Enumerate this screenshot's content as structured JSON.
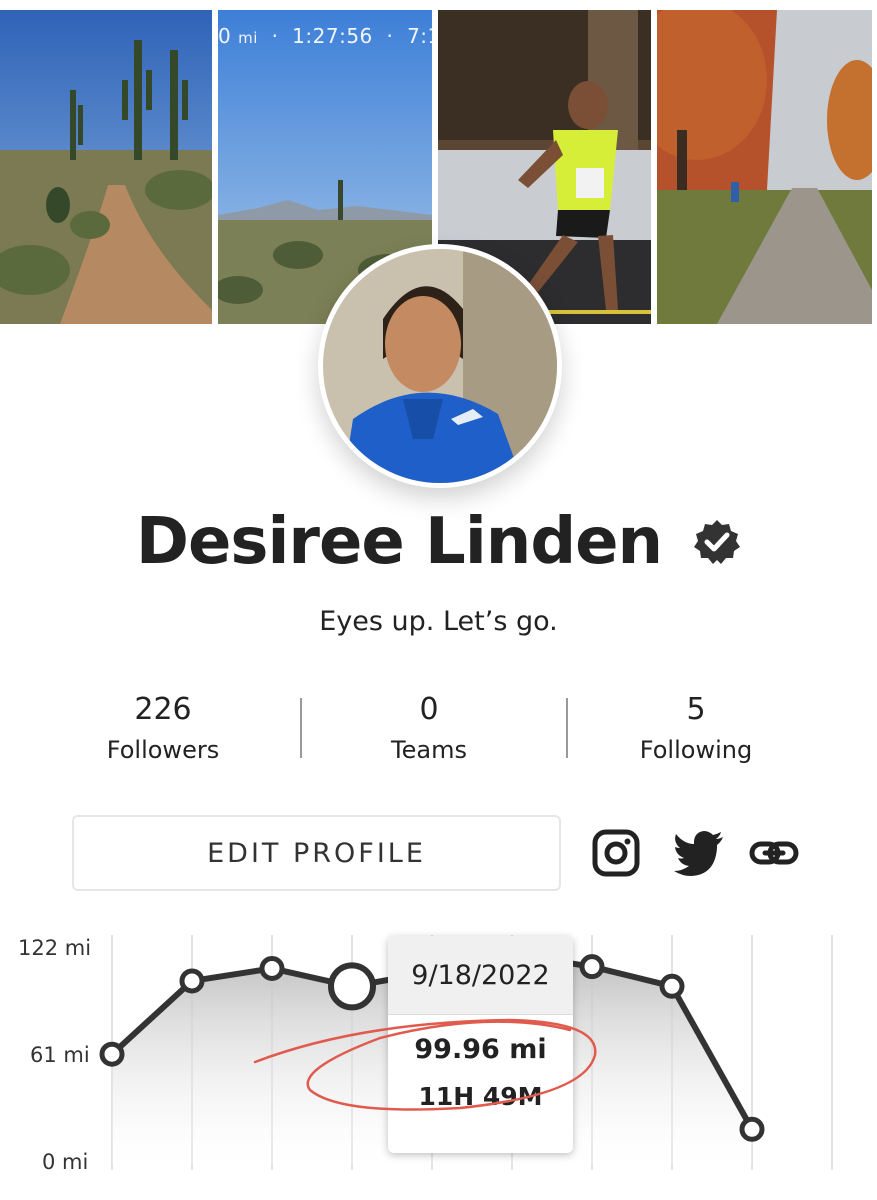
{
  "header_photos": {
    "photo2_overlay": {
      "distance_fragment": "0",
      "distance_unit": "mi",
      "separator": "·",
      "time": "1:27:56",
      "pace_fragment": "7:1"
    }
  },
  "profile": {
    "name": "Desiree Linden",
    "tagline": "Eyes up. Let’s go.",
    "verified_icon": "verified-badge-icon"
  },
  "stats": [
    {
      "value": "226",
      "label": "Followers"
    },
    {
      "value": "0",
      "label": "Teams"
    },
    {
      "value": "5",
      "label": "Following"
    }
  ],
  "actions": {
    "edit_profile_label": "EDIT PROFILE",
    "social_icons": [
      "instagram-icon",
      "twitter-icon",
      "link-icon"
    ]
  },
  "tooltip": {
    "date": "9/18/2022",
    "distance": "99.96 mi",
    "duration": "11H 49M"
  },
  "chart_data": {
    "type": "line",
    "title": "",
    "xlabel": "",
    "ylabel": "",
    "y_tick_labels": [
      "122 mi",
      "61 mi",
      "0 mi"
    ],
    "ylim": [
      0,
      122
    ],
    "x": [
      1,
      2,
      3,
      4,
      5,
      6,
      7,
      8,
      9,
      10
    ],
    "series": [
      {
        "values": [
          62,
          103,
          110,
          99.96,
          108,
          118,
          111,
          100,
          20
        ]
      }
    ],
    "selected_index": 3,
    "grid": true,
    "fill": "gradient-under-line",
    "line_color": "#333333"
  },
  "colors": {
    "text": "#222222",
    "annotation": "#e05a4e",
    "line": "#333333"
  }
}
